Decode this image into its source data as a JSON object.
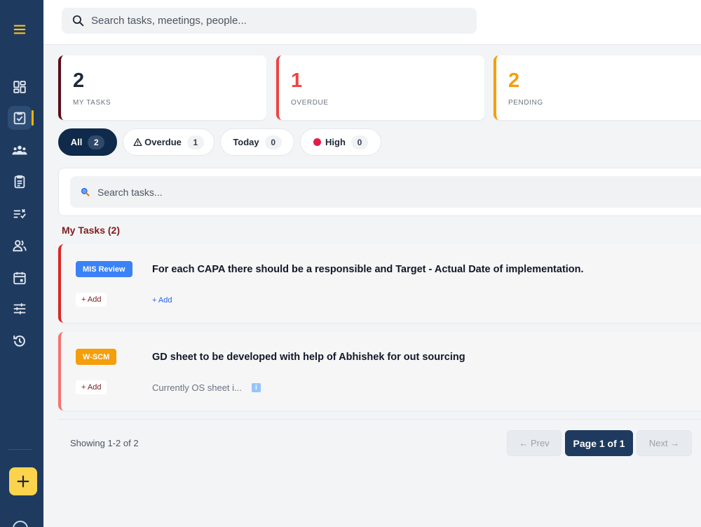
{
  "top_search": {
    "placeholder": "Search tasks, meetings, people..."
  },
  "stats": [
    {
      "value": "2",
      "label": "MY TASKS",
      "color": "#5b0d18"
    },
    {
      "value": "1",
      "label": "OVERDUE",
      "color": "#ef4444"
    },
    {
      "value": "2",
      "label": "PENDING",
      "color": "#f59e0b"
    }
  ],
  "filters": [
    {
      "label": "All",
      "count": "2"
    },
    {
      "label": "Overdue",
      "count": "1"
    },
    {
      "label": "Today",
      "count": "0"
    },
    {
      "label": "High",
      "count": "0"
    }
  ],
  "task_search": {
    "placeholder": "Search tasks..."
  },
  "section_title": "My Tasks (2)",
  "tasks": [
    {
      "tag": "MIS Review",
      "tag_color": "#3b82f6",
      "border_color": "#dc2626",
      "title": "For each CAPA there should be a responsible and Target - Actual Date of implementation.",
      "add_label": "+ Add",
      "note_link": "+ Add"
    },
    {
      "tag": "W-SCM",
      "tag_color": "#f59e0b",
      "border_color": "#f87171",
      "title": "GD sheet to be developed with help of Abhishek for out sourcing",
      "add_label": "+ Add",
      "note": "Currently OS sheet i..."
    }
  ],
  "pagination": {
    "showing": "Showing 1-2 of 2",
    "prev": "← Prev",
    "page": "Page 1 of 1",
    "next": "Next →"
  }
}
